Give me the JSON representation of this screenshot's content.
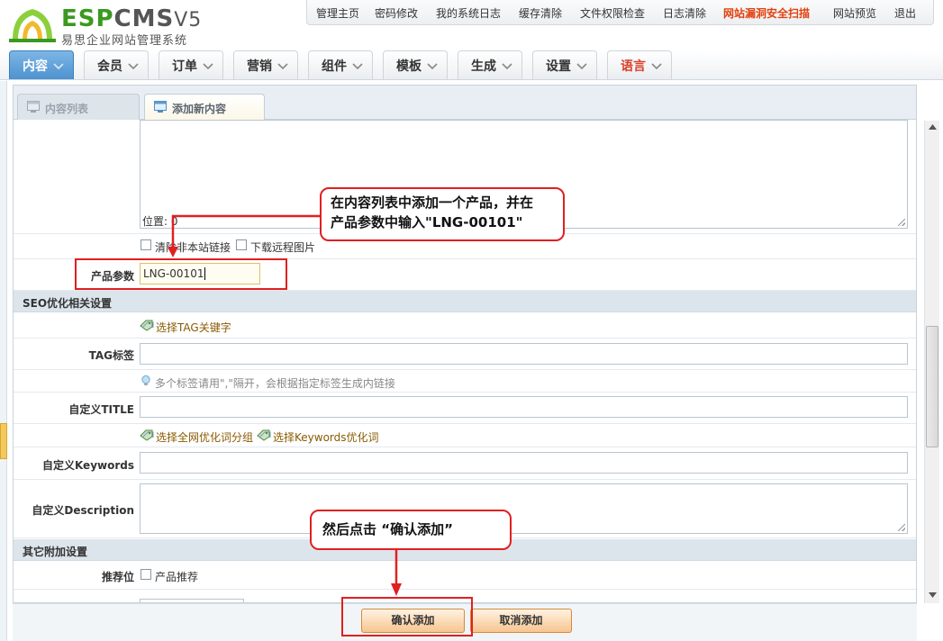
{
  "logo": {
    "esp": "ESP",
    "cms": "CMS",
    "version": "V5",
    "subtitle": "易思企业网站管理系统"
  },
  "topnav": [
    {
      "label": "管理主页",
      "highlight": false
    },
    {
      "label": "密码修改",
      "highlight": false
    },
    {
      "label": "我的系统日志",
      "highlight": false
    },
    {
      "label": "缓存清除",
      "highlight": false
    },
    {
      "label": "文件权限检查",
      "highlight": false
    },
    {
      "label": "日志清除",
      "highlight": false
    },
    {
      "label": "网站漏洞安全扫描",
      "highlight": true
    },
    {
      "label": "网站预览",
      "highlight": false
    },
    {
      "label": "退出",
      "highlight": false
    }
  ],
  "mainnav": [
    {
      "label": "内容",
      "active": true
    },
    {
      "label": "会员"
    },
    {
      "label": "订单"
    },
    {
      "label": "营销"
    },
    {
      "label": "组件"
    },
    {
      "label": "模板"
    },
    {
      "label": "生成"
    },
    {
      "label": "设置"
    },
    {
      "label": "语言",
      "lang": true
    }
  ],
  "subtabs": [
    {
      "label": "内容列表",
      "active": false
    },
    {
      "label": "添加新内容",
      "active": true
    }
  ],
  "form": {
    "position_label": "位置: 0",
    "option_clear_links": "清除非本站链接",
    "option_download_images": "下载远程图片",
    "product_param_label": "产品参数",
    "product_param_value": "LNG-00101",
    "seo_section": "SEO优化相关设置",
    "select_tag_link": "选择TAG关键字",
    "tag_label": "TAG标签",
    "tag_value": "",
    "tag_hint": "多个标签请用\",\"隔开，会根据指定标签生成内链接",
    "title_label": "自定义TITLE",
    "title_value": "",
    "select_group_link": "选择全网优化词分组",
    "select_keywords_link": "选择Keywords优化词",
    "keywords_label": "自定义Keywords",
    "keywords_value": "",
    "description_label": "自定义Description",
    "other_section": "其它附加设置",
    "recommend_label": "推荐位",
    "recommend_option": "产品推荐"
  },
  "buttons": {
    "confirm": "确认添加",
    "cancel": "取消添加"
  },
  "annotations": {
    "callout1_line1": "在内容列表中添加一个产品，并在",
    "callout1_line2": "产品参数中输入\"LNG-00101\"",
    "callout2": "然后点击 “确认添加”"
  },
  "colors": {
    "accent": "#4d92cf",
    "highlight_red": "#e2410f",
    "annotation_red": "#e02020",
    "button_orange": "#f7c58f"
  }
}
